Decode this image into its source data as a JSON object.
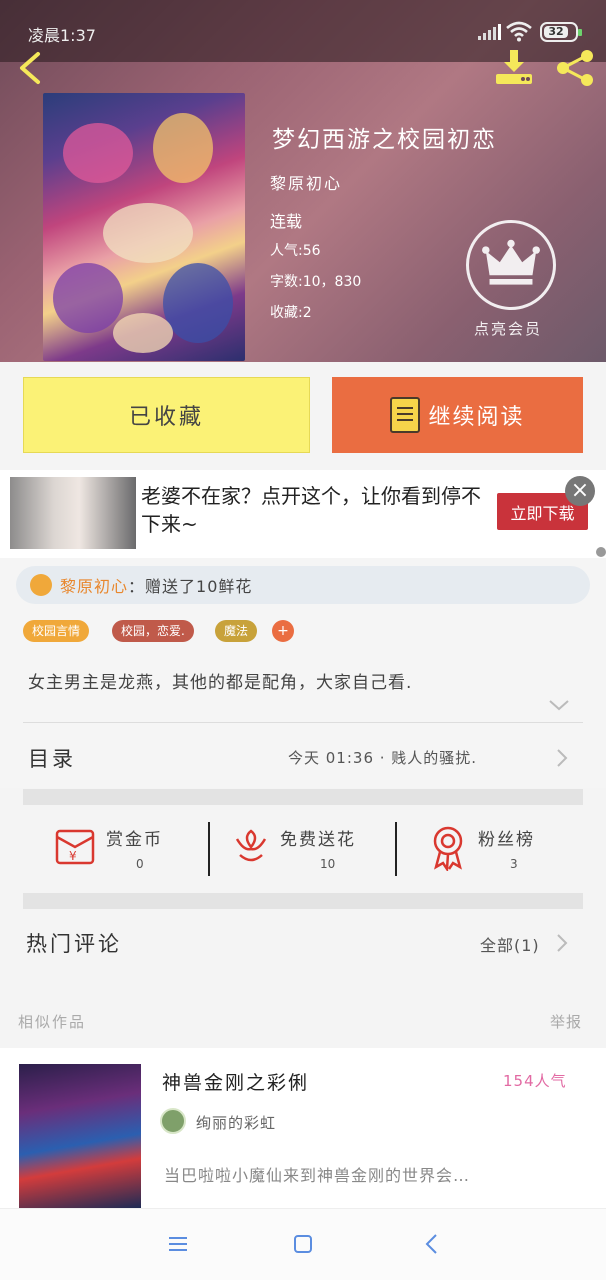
{
  "status_bar": {
    "time": "凌晨1:37",
    "battery": "32"
  },
  "book": {
    "title": "梦幻西游之校园初恋",
    "author": "黎原初心",
    "status": "连载",
    "popularity": "人气:56",
    "word_count": "字数:10，830",
    "favorites": "收藏:2"
  },
  "vip": {
    "label": "点亮会员"
  },
  "actions": {
    "favorited_label": "已收藏",
    "continue_label": "继续阅读"
  },
  "ad": {
    "text": "老婆不在家？点开这个，让你看到停不下来~",
    "button": "立即下载",
    "close": "×"
  },
  "gift": {
    "user": "黎原初心",
    "text": "：赠送了10鲜花"
  },
  "tags": [
    {
      "label": "校园言情",
      "color": "#f0a83a"
    },
    {
      "label": "校园，恋爱.",
      "color": "#c05a4a"
    },
    {
      "label": "魔法",
      "color": "#c8a23a"
    }
  ],
  "tag_add": "+",
  "intro": "女主男主是龙燕，其他的都是配角，大家自己看.",
  "toc": {
    "label": "目录",
    "latest": "今天 01:36 · 贱人的骚扰."
  },
  "stats": [
    {
      "label": "赏金币",
      "value": "0"
    },
    {
      "label": "免费送花",
      "value": "10"
    },
    {
      "label": "粉丝榜",
      "value": "3"
    }
  ],
  "comments": {
    "title": "热门评论",
    "all": "全部(1)"
  },
  "similar": {
    "title": "相似作品",
    "report": "举报"
  },
  "recommendation": {
    "title": "神兽金刚之彩俐",
    "popularity": "154人气",
    "author": "绚丽的彩虹",
    "description": "当巴啦啦小魔仙来到神兽金刚的世界会…"
  },
  "colors": {
    "accent_orange": "#ea6d41",
    "favorite_yellow": "#fbf276",
    "ad_red": "#c9333b"
  }
}
